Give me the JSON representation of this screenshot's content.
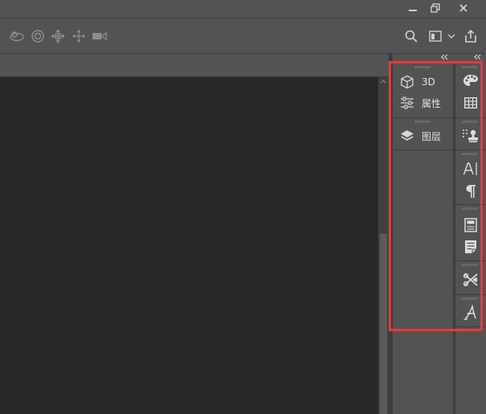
{
  "window_controls": {
    "icons": [
      "minimize-icon",
      "restore-icon",
      "close-icon"
    ]
  },
  "options_bar": {
    "mode_3d_tools": [
      "orbit-3d-icon",
      "roll-3d-icon",
      "pan-3d-icon",
      "slide-3d-icon",
      "scale-3d-icon"
    ],
    "right_tools": [
      "search-icon",
      "workspace-icon",
      "chevron-down-icon",
      "share-icon"
    ]
  },
  "panels": {
    "group1": [
      {
        "label": "3D",
        "icon": "cube-icon"
      },
      {
        "label": "属性",
        "icon": "sliders-icon"
      }
    ],
    "group2": [
      {
        "label": "图层",
        "icon": "layers-icon"
      }
    ]
  },
  "icon_strip": [
    "palette-icon",
    "swatches-icon",
    "clone-source-icon",
    "character-icon",
    "paragraph-icon",
    "paragraph-styles-icon",
    "character-styles-icon",
    "tool-presets-icon",
    "glyphs-icon"
  ],
  "colors": {
    "background": "#535353",
    "canvas": "#282828",
    "highlight": "#e8383b"
  }
}
